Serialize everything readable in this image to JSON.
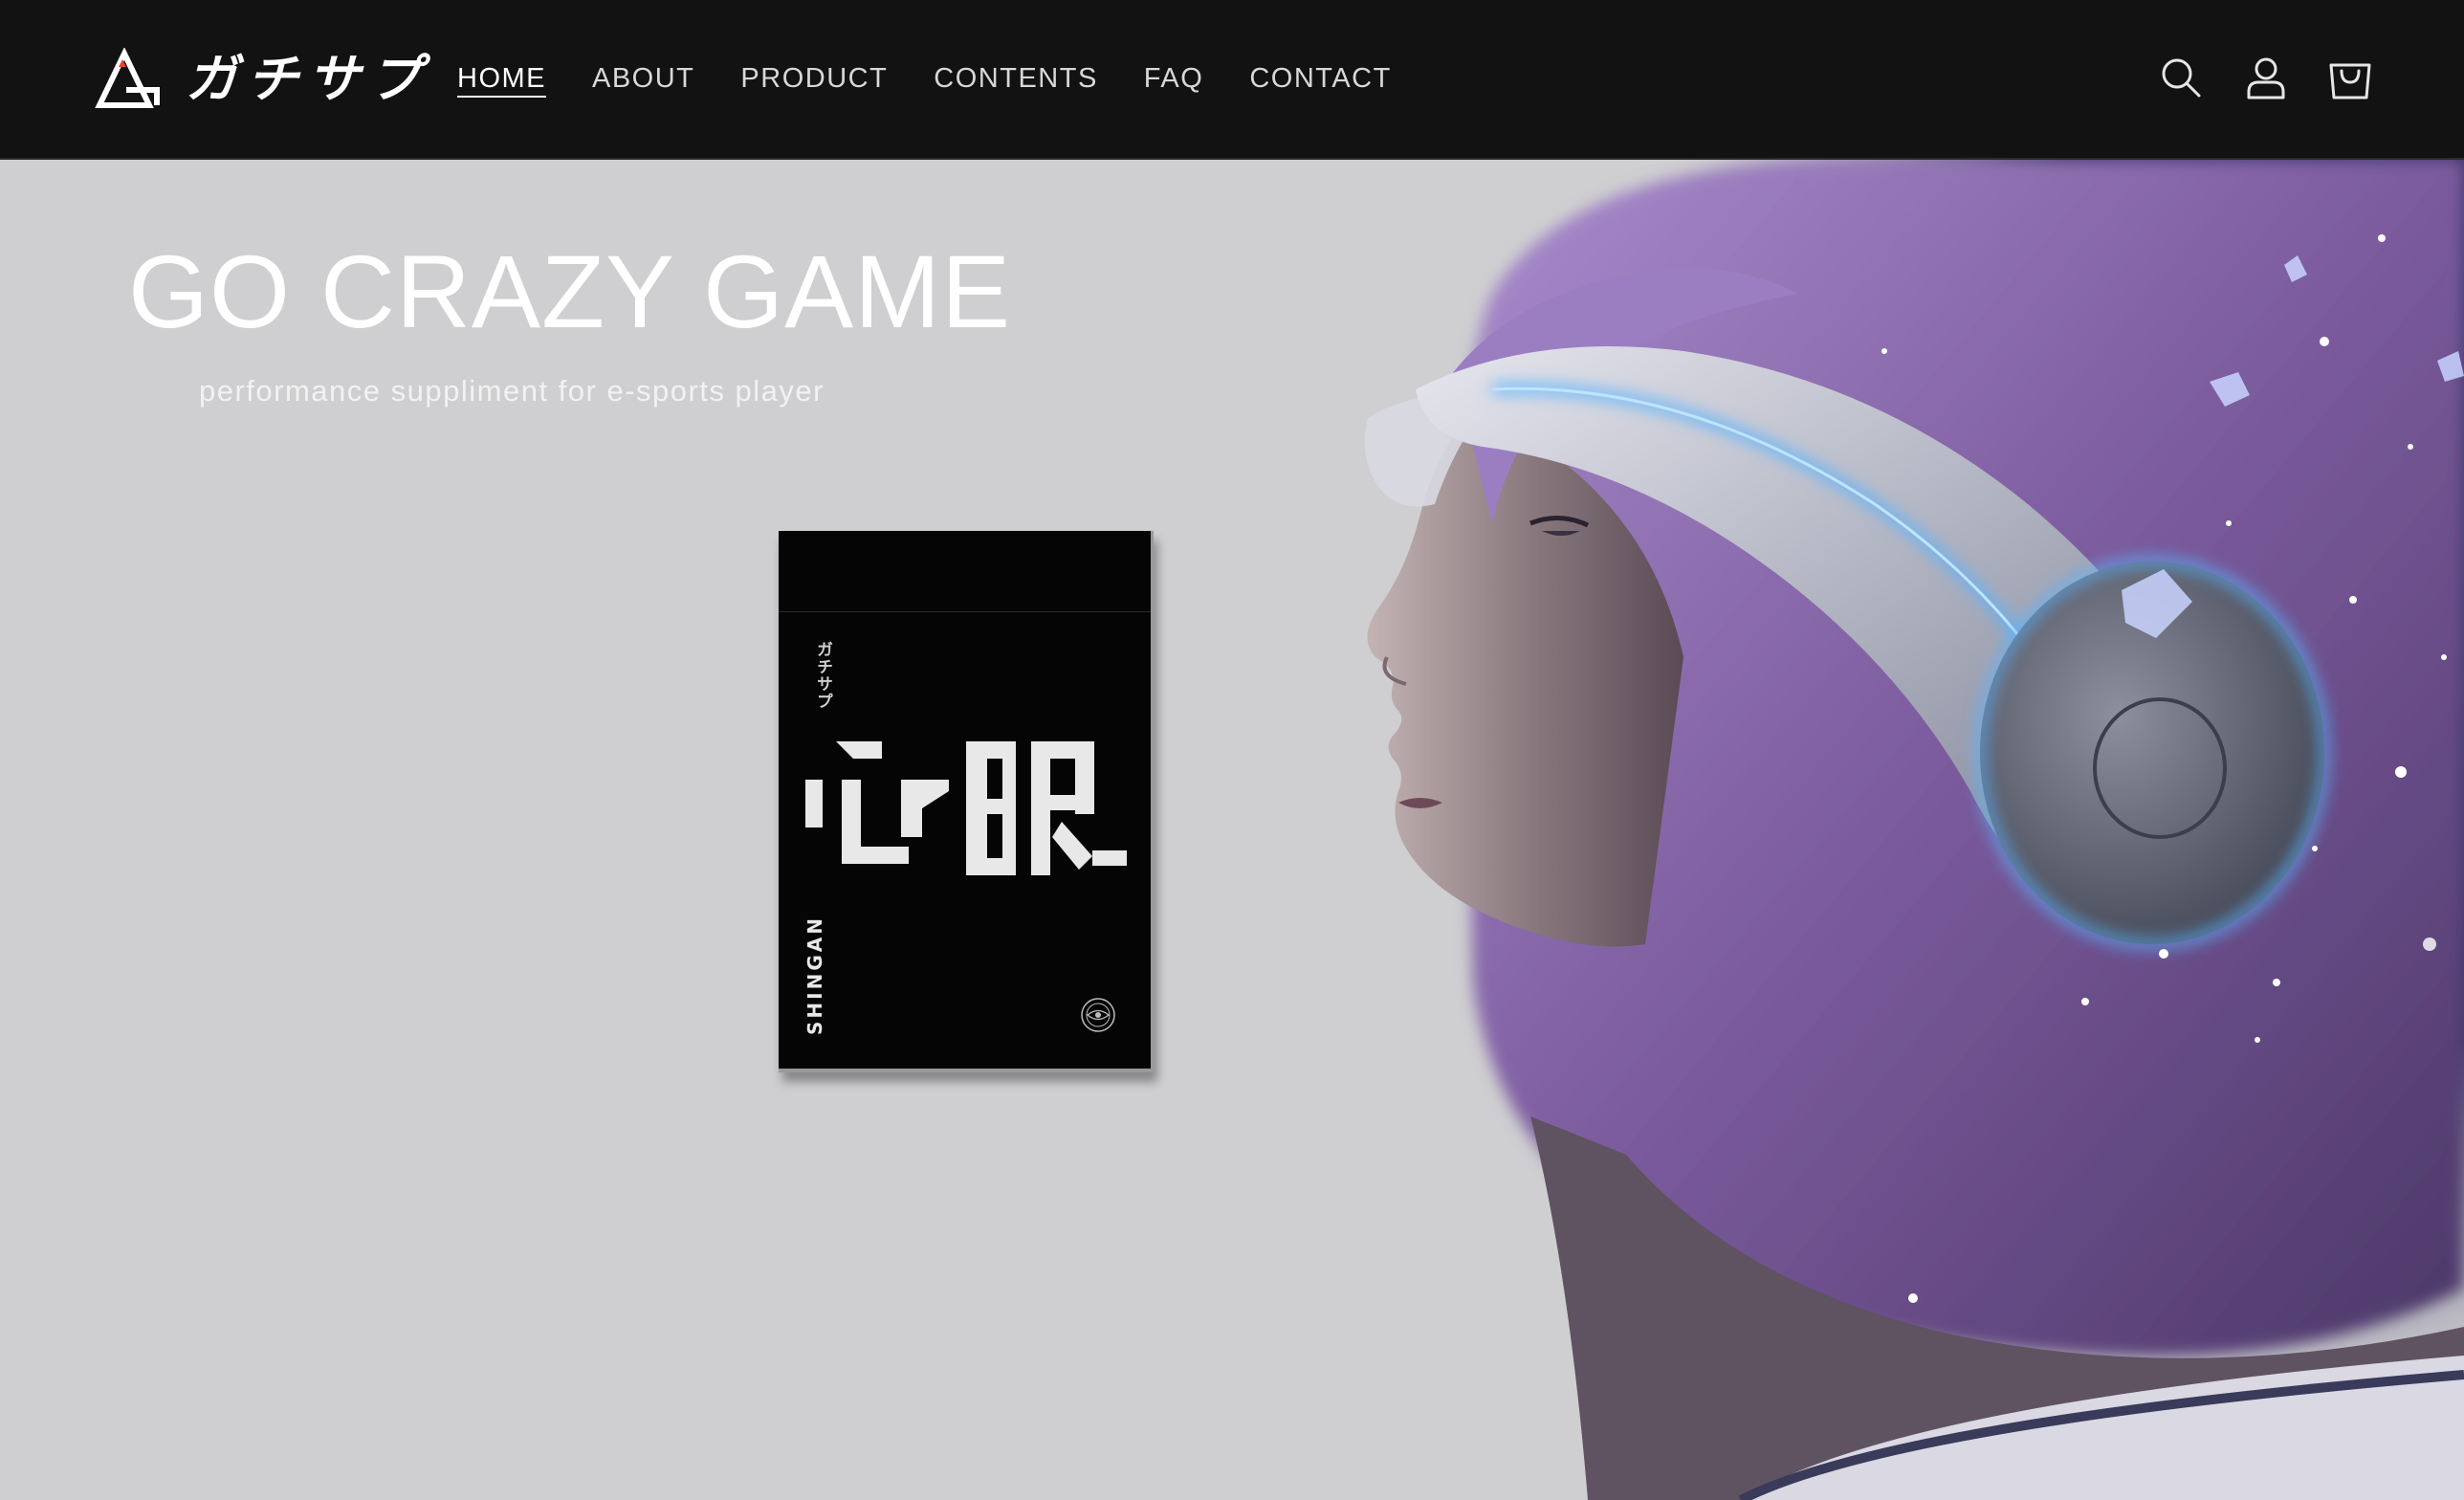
{
  "header": {
    "logo_text": "ガチサプ",
    "nav": [
      {
        "label": "HOME",
        "active": true
      },
      {
        "label": "ABOUT"
      },
      {
        "label": "PRODUCT"
      },
      {
        "label": "CONTENTS"
      },
      {
        "label": "FAQ"
      },
      {
        "label": "CONTACT"
      }
    ],
    "icons": [
      "search-icon",
      "account-icon",
      "cart-icon"
    ]
  },
  "hero": {
    "title": "GO CRAZY GAME",
    "subtitle": "performance suppliment for e-sports player",
    "product": {
      "brand": "ガチサプ",
      "kanji": "心眼",
      "name": "SHINGAN"
    }
  },
  "colors": {
    "header_bg": "#121212",
    "hero_bg": "#cfcfd1",
    "hair": "#7a5a9c",
    "headphone_glow": "#5ab4ff",
    "logo_accent": "#e8412f"
  }
}
